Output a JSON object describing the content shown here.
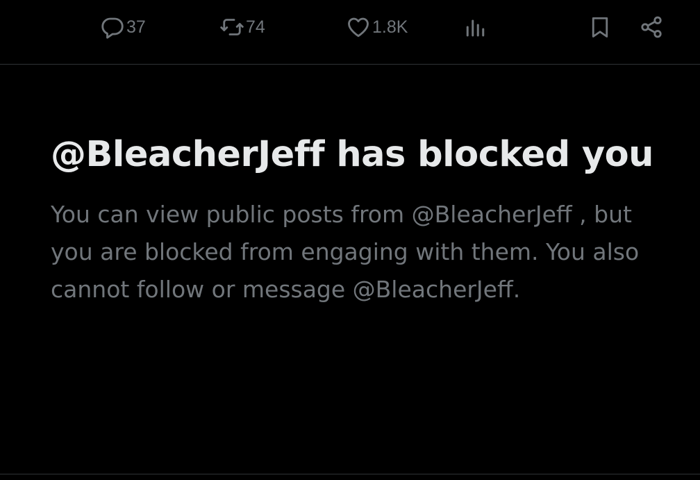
{
  "actions": {
    "reply": {
      "icon": "reply-icon",
      "count": "37"
    },
    "repost": {
      "icon": "repost-icon",
      "count": "74"
    },
    "like": {
      "icon": "heart-icon",
      "count": "1.8K"
    },
    "views": {
      "icon": "views-icon"
    },
    "bookmark": {
      "icon": "bookmark-icon"
    },
    "share": {
      "icon": "share-icon"
    }
  },
  "notice": {
    "title": "@BleacherJeff has blocked you",
    "body": "You can view public posts from @BleacherJeff , but you are blocked from engaging with them. You also cannot follow or message @BleacherJeff."
  },
  "colors": {
    "background": "#000000",
    "primary_text": "#e7e9ea",
    "secondary_text": "#71767b",
    "divider": "#2f3336"
  }
}
